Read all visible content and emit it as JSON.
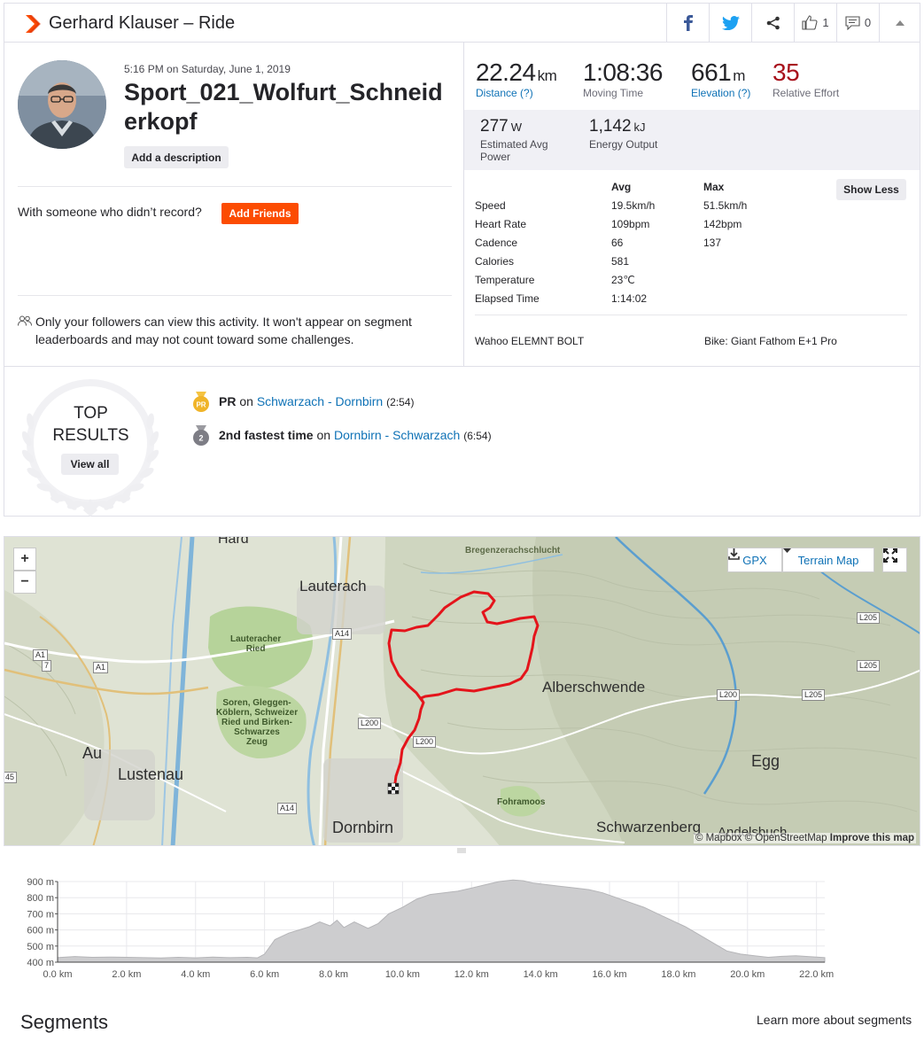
{
  "header": {
    "title": "Gerhard Klauser – Ride",
    "kudos_count": "1",
    "comments_count": "0",
    "icons": [
      "strava-chevron-icon",
      "facebook-icon",
      "twitter-icon",
      "share-icon",
      "thumbs-up-icon",
      "comment-icon",
      "caret-up-icon"
    ]
  },
  "activity": {
    "date": "5:16 PM on Saturday, June 1, 2019",
    "name": "Sport_021_Wolfurt_Schneiderkopf",
    "add_description": "Add a description",
    "someone_text": "With someone who didn’t record?",
    "add_friends": "Add Friends",
    "privacy_text": "Only your followers can view this activity. It won't appear on segment leaderboards and may not count toward some challenges."
  },
  "stats": {
    "distance": {
      "value": "22.24",
      "unit": "km",
      "label": "Distance (?)"
    },
    "moving_time": {
      "value": "1:08:36",
      "label": "Moving Time"
    },
    "elevation": {
      "value": "661",
      "unit": "m",
      "label": "Elevation (?)"
    },
    "relative_effort": {
      "value": "35",
      "label": "Relative Effort"
    },
    "power": {
      "value": "277",
      "unit": "W",
      "label_line1": "Estimated Avg",
      "label_line2": "Power"
    },
    "energy": {
      "value": "1,142",
      "unit": "kJ",
      "label": "Energy Output"
    }
  },
  "more_stats": {
    "col_avg": "Avg",
    "col_max": "Max",
    "show_less": "Show Less",
    "rows": [
      {
        "label": "Speed",
        "avg": "19.5km/h",
        "max": "51.5km/h"
      },
      {
        "label": "Heart Rate",
        "avg": "109bpm",
        "max": "142bpm"
      },
      {
        "label": "Cadence",
        "avg": "66",
        "max": "137"
      },
      {
        "label": "Calories",
        "avg": "581",
        "max": ""
      },
      {
        "label": "Temperature",
        "avg": "23℃",
        "max": ""
      },
      {
        "label": "Elapsed Time",
        "avg": "1:14:02",
        "max": ""
      }
    ],
    "device": "Wahoo ELEMNT BOLT",
    "bike": "Bike: Giant Fathom E+1 Pro"
  },
  "top_results": {
    "label_line1": "TOP",
    "label_line2": "RESULTS",
    "view_all": "View all",
    "achievements": [
      {
        "medal_text": "PR",
        "bold": "PR",
        "on": " on ",
        "segment": "Schwarzach - Dornbirn",
        "time": "(2:54)"
      },
      {
        "medal_text": "2",
        "bold": "2nd fastest time",
        "on": " on ",
        "segment": "Dornbirn - Schwarzach",
        "time": "(6:54)"
      }
    ]
  },
  "map": {
    "zoom_in": "+",
    "zoom_out": "−",
    "gpx": "GPX",
    "map_type": "Terrain Map",
    "attribution_1": "© Mapbox © OpenStreetMap",
    "attribution_2": "Improve this map",
    "places": {
      "hard": "Hard",
      "lauterach": "Lauterach",
      "bregenzerach": "Bregenzerachschlucht",
      "lauteracher_ried_1": "Lauteracher",
      "lauteracher_ried_2": "Ried",
      "soren_1": "Soren, Gleggen-",
      "soren_2": "Köblern, Schweizer",
      "soren_3": "Ried und Birken-",
      "soren_4": "Schwarzes",
      "soren_5": "Zeug",
      "alberschwende": "Alberschwende",
      "au": "Au",
      "lustenau": "Lustenau",
      "egg": "Egg",
      "fohramoos": "Fohramoos",
      "dornbirn": "Dornbirn",
      "schwarzenberg": "Schwarzenberg",
      "andelsbuch": "Andelsbuch"
    },
    "roads": {
      "a1a": "A1",
      "a7": "7",
      "a1b": "A1",
      "a14a": "A14",
      "a14b": "A14",
      "l200a": "L200",
      "l200b": "L200",
      "l200c": "L200",
      "l205a": "L205",
      "l205b": "L205",
      "l205c": "L205",
      "r45": "45"
    }
  },
  "chart_data": {
    "type": "area",
    "title": "",
    "xlabel": "",
    "ylabel": "",
    "xlim": [
      0,
      22.24
    ],
    "ylim": [
      400,
      900
    ],
    "x_ticks": [
      "0.0 km",
      "2.0 km",
      "4.0 km",
      "6.0 km",
      "8.0 km",
      "10.0 km",
      "12.0 km",
      "14.0 km",
      "16.0 km",
      "18.0 km",
      "20.0 km",
      "22.0 km"
    ],
    "y_ticks": [
      "400 m",
      "500 m",
      "600 m",
      "700 m",
      "800 m",
      "900 m"
    ],
    "grid": true,
    "series": [
      {
        "x": [
          0,
          0.5,
          1.0,
          1.5,
          2.0,
          2.5,
          3.0,
          3.5,
          4.0,
          4.5,
          5.0,
          5.5,
          5.8,
          6.0,
          6.3,
          6.7,
          7.0,
          7.3,
          7.6,
          7.9,
          8.1,
          8.3,
          8.6,
          9.0,
          9.3,
          9.6,
          10.0,
          10.4,
          10.8,
          11.2,
          11.6,
          12.0,
          12.4,
          12.8,
          13.2,
          13.5,
          13.8,
          14.2,
          14.6,
          15.0,
          15.4,
          15.8,
          16.2,
          16.6,
          17.0,
          17.4,
          17.8,
          18.2,
          18.6,
          19.0,
          19.4,
          19.8,
          20.2,
          20.6,
          21.0,
          21.4,
          21.8,
          22.24
        ],
        "y": [
          428,
          435,
          430,
          432,
          430,
          428,
          426,
          430,
          427,
          432,
          428,
          430,
          427,
          450,
          540,
          580,
          600,
          620,
          650,
          625,
          660,
          615,
          650,
          610,
          640,
          700,
          740,
          790,
          820,
          830,
          840,
          860,
          880,
          900,
          910,
          905,
          890,
          880,
          870,
          860,
          850,
          830,
          800,
          770,
          740,
          700,
          660,
          620,
          570,
          520,
          470,
          450,
          440,
          430,
          436,
          440,
          434,
          428
        ]
      }
    ]
  },
  "segments": {
    "title": "Segments",
    "learn_more": "Learn more about segments"
  }
}
